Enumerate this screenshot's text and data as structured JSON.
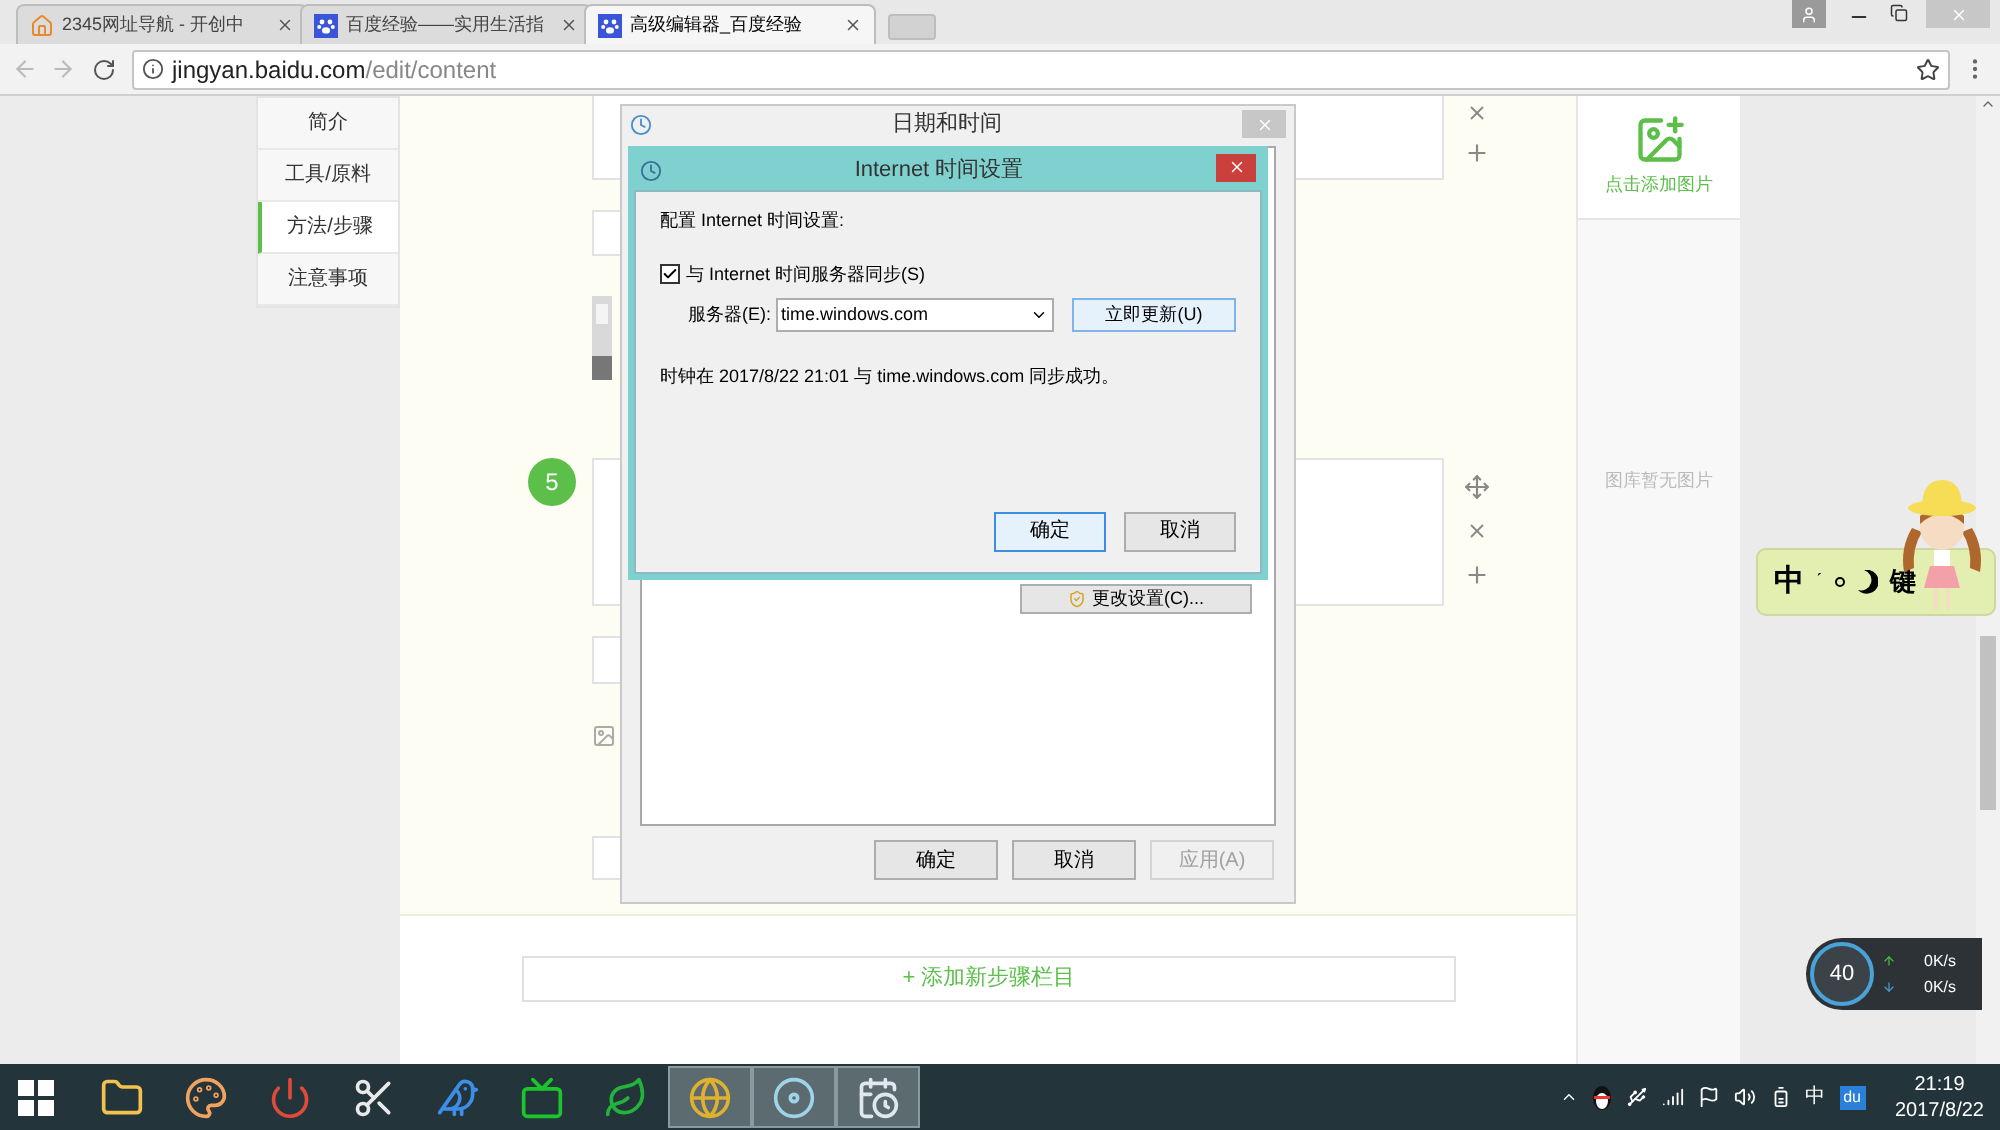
{
  "browser": {
    "tabs": [
      {
        "title": "2345网址导航 - 开创中",
        "kind": "house",
        "selected": false
      },
      {
        "title": "百度经验——实用生活指",
        "kind": "paw",
        "selected": false
      },
      {
        "title": "高级编辑器_百度经验",
        "kind": "paw",
        "selected": true
      }
    ],
    "address": {
      "host": "jingyan.baidu.com",
      "path": "/edit/content"
    }
  },
  "sidebar": {
    "items": [
      {
        "label": "简介",
        "selected": false
      },
      {
        "label": "工具/原料",
        "selected": false
      },
      {
        "label": "方法/步骤",
        "selected": true
      },
      {
        "label": "注意事项",
        "selected": false
      }
    ]
  },
  "editor": {
    "step_number": "5",
    "add_step_button": "+ 添加新步骤栏目"
  },
  "image_panel": {
    "add_label": "点击添加图片",
    "empty_text": "图库暂无图片"
  },
  "date_time_dialog": {
    "title": "日期和时间",
    "change_settings_button": "更改设置(C)...",
    "buttons": [
      {
        "label": "确定",
        "disabled": false
      },
      {
        "label": "取消",
        "disabled": false
      },
      {
        "label": "应用(A)",
        "disabled": true
      }
    ]
  },
  "internet_time_dialog": {
    "title": "Internet 时间设置",
    "heading": "配置 Internet 时间设置:",
    "sync_checkbox": {
      "label": "与 Internet 时间服务器同步(S)",
      "checked": true
    },
    "server_label": "服务器(E):",
    "server_value": "time.windows.com",
    "update_button": "立即更新(U)",
    "status": "时钟在 2017/8/22 21:01 与 time.windows.com 同步成功。",
    "buttons": [
      {
        "label": "确定",
        "selected": true
      },
      {
        "label": "取消",
        "selected": false
      }
    ]
  },
  "ime_bar": {
    "mode": "中",
    "accent": "ˊ",
    "keyboard": "键"
  },
  "net_monitor": {
    "percent": "40",
    "rates": [
      "0K/s",
      "0K/s"
    ]
  },
  "taskbar": {
    "apps": [
      {
        "kind": "folder",
        "selected": false
      },
      {
        "kind": "palette",
        "selected": false
      },
      {
        "kind": "power",
        "selected": false
      },
      {
        "kind": "scissors",
        "selected": false
      },
      {
        "kind": "bird",
        "selected": false
      },
      {
        "kind": "tv",
        "selected": false
      },
      {
        "kind": "leaf",
        "selected": false
      },
      {
        "kind": "globe",
        "selected": true
      },
      {
        "kind": "disc",
        "selected": true
      },
      {
        "kind": "calendar",
        "selected": true
      }
    ],
    "tray_text": [
      "中",
      "du"
    ],
    "time": "21:19",
    "date": "2017/8/22"
  }
}
